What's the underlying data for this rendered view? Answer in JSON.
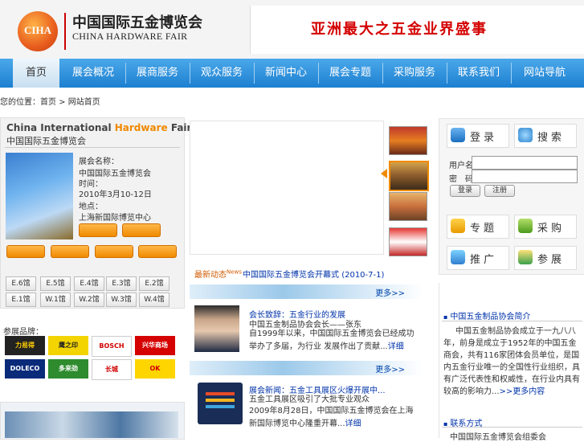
{
  "header": {
    "logo_mark": "CIHA",
    "logo_cn": "中国国际五金博览会",
    "logo_en": "CHINA HARDWARE FAIR",
    "slogan": "亚洲最大之五金业界盛事"
  },
  "nav": {
    "items": [
      "首页",
      "展会概况",
      "展商服务",
      "观众服务",
      "新闻中心",
      "展会专题",
      "采购服务",
      "联系我们",
      "网站导航"
    ]
  },
  "breadcrumb": "您的位置：首页 > 网站首页",
  "fair": {
    "title_en_pre": "China International ",
    "title_en_hl": "Hardware",
    "title_en_post": " Fair",
    "title_cn": "中国国际五金博览会",
    "info": [
      "展会名称：",
      "中国国际五金博览会",
      "时间：",
      "2010年3月10-12日",
      "地点：",
      "上海新国际博览中心"
    ],
    "date_buttons": [
      "E.6馆",
      "E.5馆",
      "E.4馆",
      "E.3馆",
      "E.2馆",
      "E.1馆",
      "W.1馆",
      "W.2馆",
      "W.3馆",
      "W.4馆"
    ]
  },
  "brands": {
    "title": "参展品牌：",
    "items": [
      "力易得",
      "鹰之印",
      "BOSCH",
      "兴华商场",
      "DOLECO",
      "多来劲",
      "长城",
      "OK"
    ]
  },
  "news": {
    "head": "最新动态",
    "head_sup": "News",
    "link_text": "中国国际五金博览会开幕式",
    "link_date": "(2010-7-1)",
    "more": "更多>>",
    "item1_title": "会长致辞：五金行业的发展",
    "item1_text1": "中国五金制品协会会长——张东",
    "item1_text2": "自1999年以来，中国国际五金博览会已经成功举办了多届，为行业 发展作出了贡献",
    "item1_more": "详细",
    "item2_title": "展会新闻：五金工具展区火爆开展中...",
    "item2_text1": "五金工具展区吸引了大批专业观众",
    "item2_text2": "2009年8月28日，中国国际五金博览会在上海新国际博览中心隆重开幕",
    "item2_more": "详细"
  },
  "login": {
    "tile_login": "登录",
    "tile_search": "搜索",
    "user_label": "用户名：",
    "pass_label": "密　码：",
    "user_value": "",
    "pass_value": "",
    "login_btn": "登录",
    "register_btn": "注册",
    "tile_topic": "专题",
    "tile_purchase": "采购",
    "tile_promote": "推广",
    "tile_visit": "参展"
  },
  "intro": {
    "title": "中国五金制品协会简介",
    "text": "中国五金制品协会成立于一九八八年，前身是成立于1952年的中国五金商会，共有116家团体会员单位，是国内五金行业唯一的全国性行业组织，具有广泛代表性和权威性，在行业内具有较高的影响力",
    "more": ">>更多内容",
    "sec2_title": "联系方式",
    "sec2_text": "中国国际五金博览会组委会"
  },
  "colors": {
    "nav_blue": "#1d7fd0",
    "accent_orange": "#f08a00",
    "slogan_red": "#d40000",
    "link_blue": "#0033aa"
  }
}
